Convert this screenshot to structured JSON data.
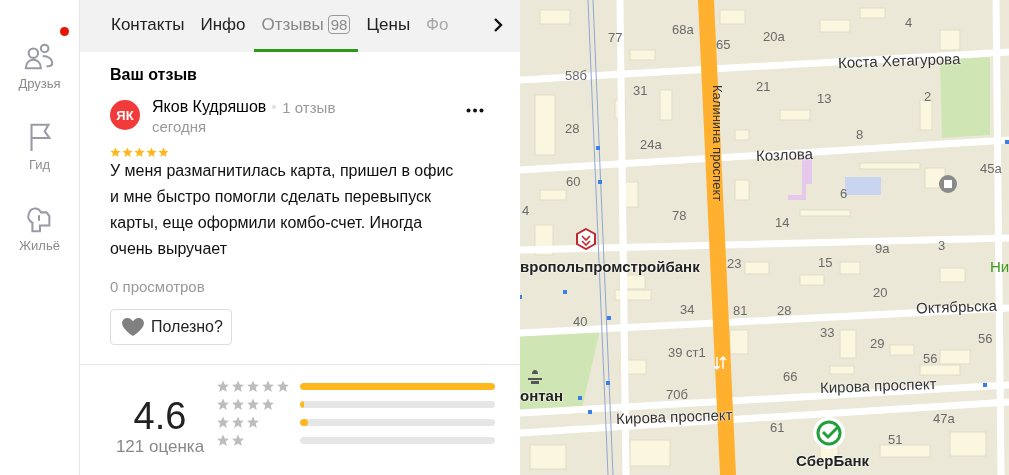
{
  "sidebar": {
    "items": [
      {
        "label": "Друзья",
        "kind": "friends",
        "notification": true
      },
      {
        "label": "Гид",
        "kind": "guide",
        "notification": false
      },
      {
        "label": "Жильё",
        "kind": "housing",
        "notification": false
      }
    ]
  },
  "tabs": [
    {
      "label": "Контакты",
      "selected": false,
      "faded": false
    },
    {
      "label": "Инфо",
      "selected": false,
      "faded": false
    },
    {
      "label": "Отзывы",
      "count": "98",
      "selected": true,
      "faded": false
    },
    {
      "label": "Цены",
      "selected": false,
      "faded": false
    },
    {
      "label": "Фо",
      "selected": false,
      "faded": true
    }
  ],
  "review": {
    "heading": "Ваш отзыв",
    "initials": "ЯК",
    "author": "Яков Кудряшов",
    "author_reviews": "1 отзыв",
    "date": "сегодня",
    "stars": 5,
    "text": "У меня размагнитилась карта, пришел в офис и мне быстро помогли сделать перевыпуск карты, еще оформили комбо-счет. Иногда очень выручает",
    "views": "0 просмотров",
    "helpful_button": "Полезно?"
  },
  "rating": {
    "score": "4.6",
    "count": "121 оценка",
    "bars": [
      {
        "level": 1
      },
      {
        "level": 0.02
      },
      {
        "level": 0.04
      },
      {
        "level": 0
      }
    ]
  },
  "map": {
    "labels": [
      {
        "text": "77",
        "kind": "house"
      },
      {
        "text": "68а",
        "kind": "house"
      },
      {
        "text": "65",
        "kind": "house"
      },
      {
        "text": "20а",
        "kind": "house"
      },
      {
        "text": "4",
        "kind": "house"
      },
      {
        "text": "58б",
        "kind": "house"
      },
      {
        "text": "31",
        "kind": "house"
      },
      {
        "text": "Калинина проспект",
        "kind": "avenue"
      },
      {
        "text": "21",
        "kind": "house"
      },
      {
        "text": "13",
        "kind": "house"
      },
      {
        "text": "Коста Хетагурова",
        "kind": "street"
      },
      {
        "text": "2",
        "kind": "house"
      },
      {
        "text": "28",
        "kind": "house"
      },
      {
        "text": "24а",
        "kind": "house"
      },
      {
        "text": "Козлова",
        "kind": "street"
      },
      {
        "text": "8",
        "kind": "house"
      },
      {
        "text": "60",
        "kind": "house"
      },
      {
        "text": "6",
        "kind": "house"
      },
      {
        "text": "45а",
        "kind": "house"
      },
      {
        "text": "4",
        "kind": "house"
      },
      {
        "text": "78",
        "kind": "house"
      },
      {
        "text": "14",
        "kind": "house"
      },
      {
        "text": "вропольпромстройбанк",
        "kind": "poi"
      },
      {
        "text": "23",
        "kind": "house"
      },
      {
        "text": "15",
        "kind": "house"
      },
      {
        "text": "9а",
        "kind": "house"
      },
      {
        "text": "3",
        "kind": "house"
      },
      {
        "text": "Ни",
        "kind": "park"
      },
      {
        "text": "20",
        "kind": "house"
      },
      {
        "text": "40",
        "kind": "house"
      },
      {
        "text": "34",
        "kind": "house"
      },
      {
        "text": "81",
        "kind": "house"
      },
      {
        "text": "28",
        "kind": "house"
      },
      {
        "text": "Октябрьска",
        "kind": "street"
      },
      {
        "text": "39 ст1",
        "kind": "house"
      },
      {
        "text": "33",
        "kind": "house"
      },
      {
        "text": "29",
        "kind": "house"
      },
      {
        "text": "56",
        "kind": "house"
      },
      {
        "text": "56",
        "kind": "house"
      },
      {
        "text": "онтан",
        "kind": "poi"
      },
      {
        "text": "70б",
        "kind": "house"
      },
      {
        "text": "66",
        "kind": "house"
      },
      {
        "text": "Кирова проспект",
        "kind": "street"
      },
      {
        "text": "Кирова проспект",
        "kind": "street"
      },
      {
        "text": "61",
        "kind": "house"
      },
      {
        "text": "47а",
        "kind": "house"
      },
      {
        "text": "51",
        "kind": "house"
      },
      {
        "text": "СберБанк",
        "kind": "poi"
      }
    ]
  }
}
